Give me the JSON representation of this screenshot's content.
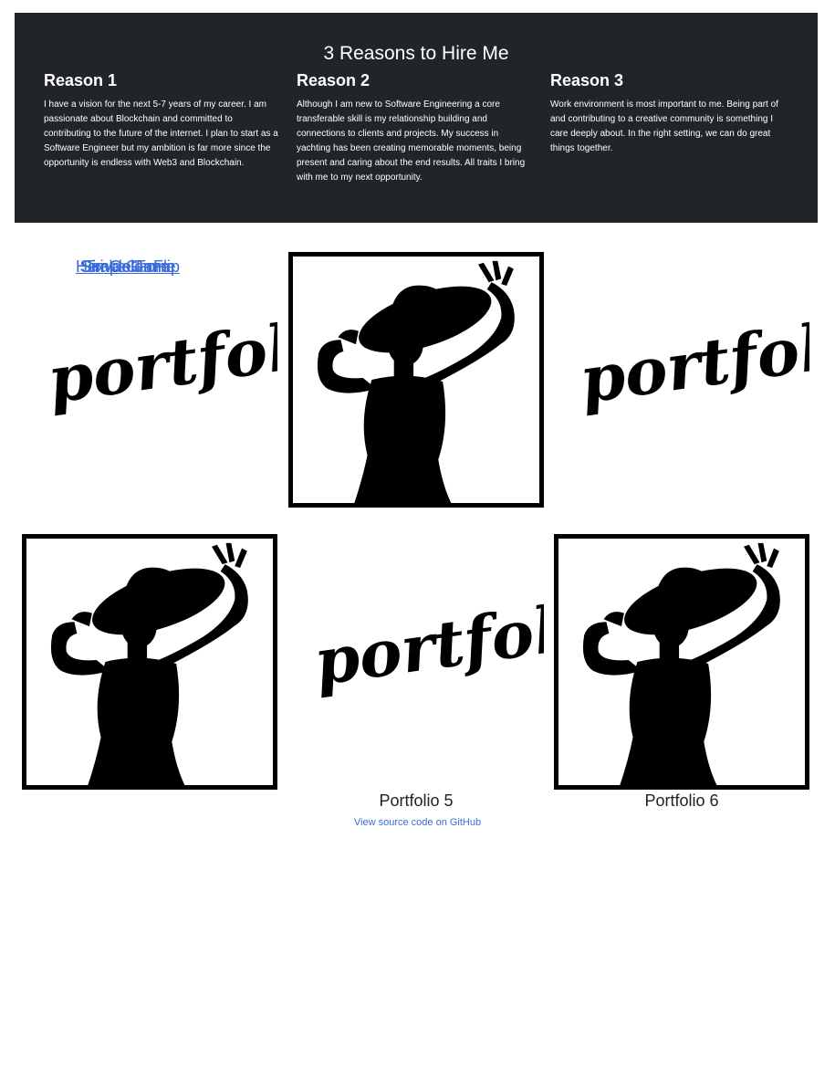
{
  "hero": {
    "title": "3 Reasons to Hire Me",
    "reasons": [
      {
        "heading": "Reason 1",
        "text": "I have a vision for the next 5-7 years of my career. I am passionate about Blockchain and committed to contributing to the future of the internet. I plan to start as a Software Engineer but my ambition is far more since the opportunity is endless with Web3 and Blockchain."
      },
      {
        "heading": "Reason 2",
        "text": "Although I am new to Software Engineering a core transferable skill is my relationship building and connections to clients and projects. My success in yachting has been creating memorable moments, being present and caring about the end results. All traits I bring with me to my next opportunity."
      },
      {
        "heading": "Reason 3",
        "text": "Work environment is most important to me. Being part of and contributing to a creative community is something I care deeply about. In the right setting, we can do great things together."
      }
    ]
  },
  "portfolio": {
    "logo_word": "portfolio",
    "items": [
      {
        "label": "Snake Game",
        "image": "portfolio-logo",
        "link": true
      },
      {
        "label": "Simple Form",
        "image": "silhouette-hat-photo",
        "link": true
      },
      {
        "label": "Hex Color Flip",
        "image": "portfolio-logo",
        "link": true
      },
      {
        "label": "Triva Game",
        "image": "silhouette-hat-photo",
        "link": true
      },
      {
        "label": "Portfolio 5",
        "image": "portfolio-logo",
        "link": false
      },
      {
        "label": "Portfolio 6",
        "image": "silhouette-hat-photo",
        "link": false
      }
    ]
  },
  "footer": {
    "link_text": "View source code on GitHub"
  }
}
